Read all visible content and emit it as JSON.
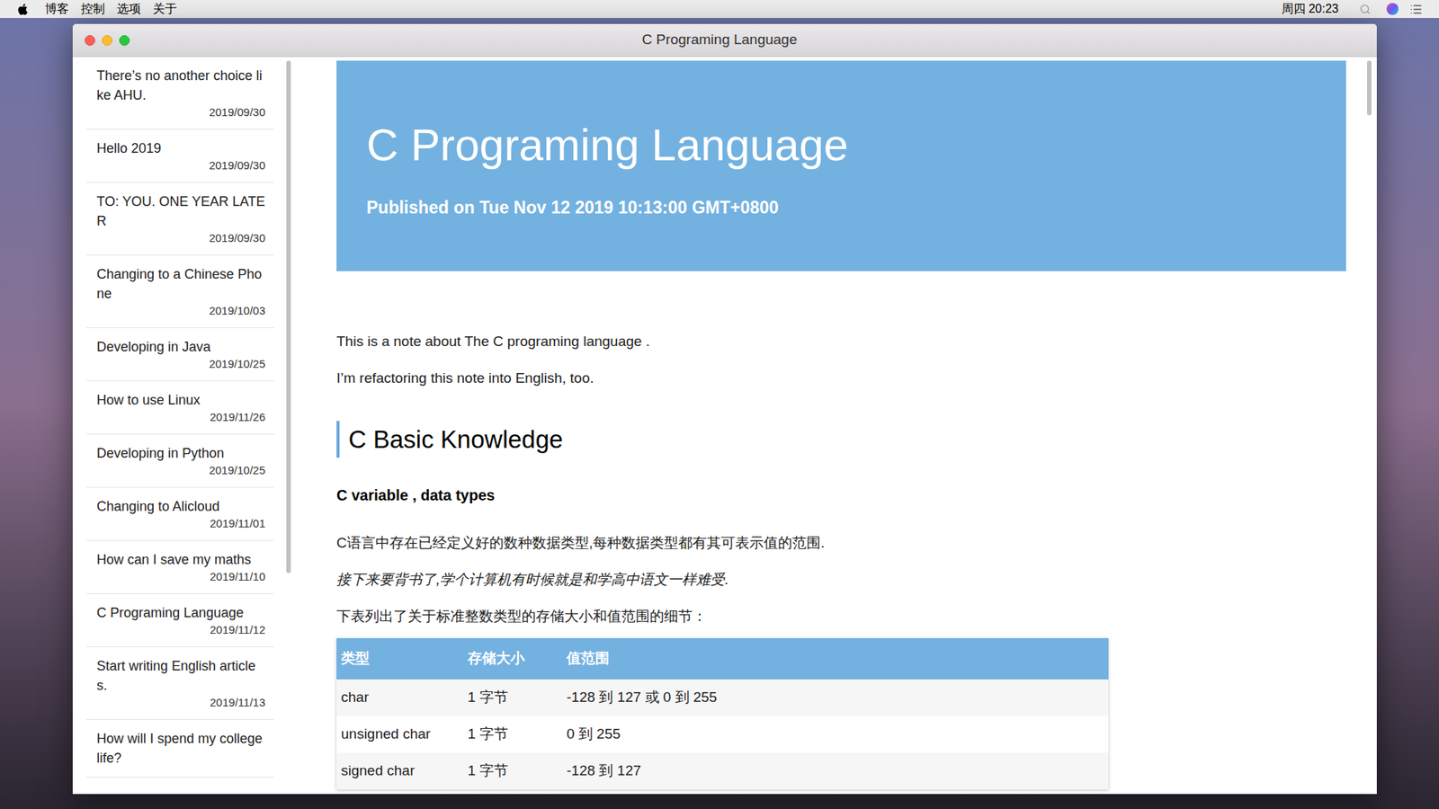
{
  "menu_bar": {
    "items": [
      "博客",
      "控制",
      "选项",
      "关于"
    ],
    "clock": "周四 20:23"
  },
  "window": {
    "title": "C Programing Language"
  },
  "sidebar": {
    "items": [
      {
        "title": "There’s no another choice like AHU.",
        "date": "2019/09/30",
        "selected": false
      },
      {
        "title": "Hello 2019",
        "date": "2019/09/30",
        "selected": false
      },
      {
        "title": "TO: YOU. ONE YEAR LATER",
        "date": "2019/09/30",
        "selected": false
      },
      {
        "title": "Changing to a Chinese Phone",
        "date": "2019/10/03",
        "selected": false
      },
      {
        "title": "Developing in Java",
        "date": "2019/10/25",
        "selected": false
      },
      {
        "title": "How to use Linux",
        "date": "2019/11/26",
        "selected": false
      },
      {
        "title": "Developing in Python",
        "date": "2019/10/25",
        "selected": false
      },
      {
        "title": "Changing to Alicloud",
        "date": "2019/11/01",
        "selected": false
      },
      {
        "title": "How can I save my maths",
        "date": "2019/11/10",
        "selected": false
      },
      {
        "title": "C Programing Language",
        "date": "2019/11/12",
        "selected": false
      },
      {
        "title": "Start writing English articles.",
        "date": "2019/11/13",
        "selected": false
      },
      {
        "title": "How will I spend my college life?",
        "date": "",
        "selected": false
      }
    ]
  },
  "article": {
    "title": "C Programing Language",
    "published": "Published on Tue Nov 12 2019 10:13:00 GMT+0800",
    "blocks": [
      {
        "kind": "paragraph",
        "text": "This is a note about The C programing language ."
      },
      {
        "kind": "paragraph",
        "text": "I’m refactoring this note into English, too."
      },
      {
        "kind": "heading",
        "text": "C Basic Knowledge"
      },
      {
        "kind": "subheading",
        "text": "C variable , data types"
      },
      {
        "kind": "paragraph",
        "text": "C语言中存在已经定义好的数种数据类型,每种数据类型都有其可表示值的范围."
      },
      {
        "kind": "italic",
        "text": "接下来要背书了,学个计算机有时候就是和学高中语文一样难受."
      },
      {
        "kind": "paragraph",
        "text": "下表列出了关于标准整数类型的存储大小和值范围的细节："
      }
    ],
    "table": {
      "columns": [
        "类型",
        "存储大小",
        "值范围"
      ],
      "rows": [
        [
          "char",
          "1 字节",
          "-128 到 127 或 0 到 255"
        ],
        [
          "unsigned char",
          "1 字节",
          "0 到 255"
        ],
        [
          "signed char",
          "1 字节",
          "-128 到 127"
        ]
      ]
    }
  }
}
